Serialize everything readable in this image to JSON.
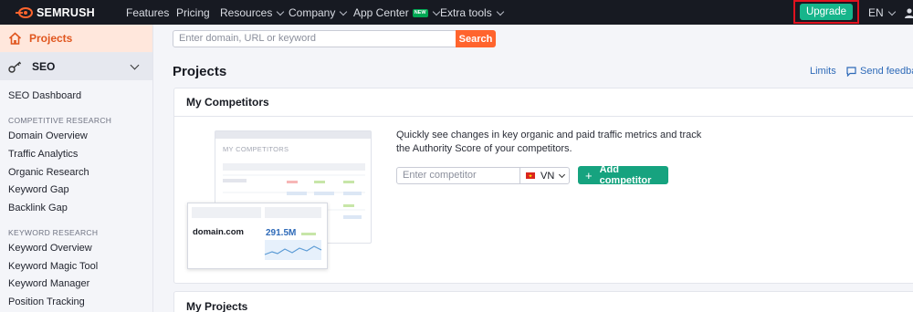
{
  "brand": {
    "name": "SEMRUSH",
    "accent": "#ff642d"
  },
  "topnav": {
    "items": [
      {
        "label": "Features",
        "dropdown": false
      },
      {
        "label": "Pricing",
        "dropdown": false
      },
      {
        "label": "Resources",
        "dropdown": true
      },
      {
        "label": "Company",
        "dropdown": true
      },
      {
        "label": "App Center",
        "dropdown": true,
        "badge": "NEW"
      },
      {
        "label": "Extra tools",
        "dropdown": true
      }
    ],
    "upgrade_label": "Upgrade",
    "language": "EN"
  },
  "sidebar": {
    "projects_label": "Projects",
    "seo_label": "SEO",
    "dashboard": "SEO Dashboard",
    "sections": [
      {
        "title": "COMPETITIVE RESEARCH",
        "items": [
          "Domain Overview",
          "Traffic Analytics",
          "Organic Research",
          "Keyword Gap",
          "Backlink Gap"
        ]
      },
      {
        "title": "KEYWORD RESEARCH",
        "items": [
          "Keyword Overview",
          "Keyword Magic Tool",
          "Keyword Manager",
          "Position Tracking"
        ]
      }
    ]
  },
  "search": {
    "placeholder": "Enter domain, URL or keyword",
    "button": "Search"
  },
  "main": {
    "title": "Projects",
    "limits": "Limits",
    "feedback": "Send feedback",
    "competitors": {
      "title": "My Competitors",
      "description": "Quickly see changes in key organic and paid traffic metrics and track the Authority Score of your competitors.",
      "input_placeholder": "Enter competitor",
      "country": "VN",
      "add_button": "Add competitor",
      "illustration": {
        "header": "MY COMPETITORS",
        "domain": "domain.com",
        "value": "291.5M"
      }
    },
    "projects_title": "My Projects"
  }
}
